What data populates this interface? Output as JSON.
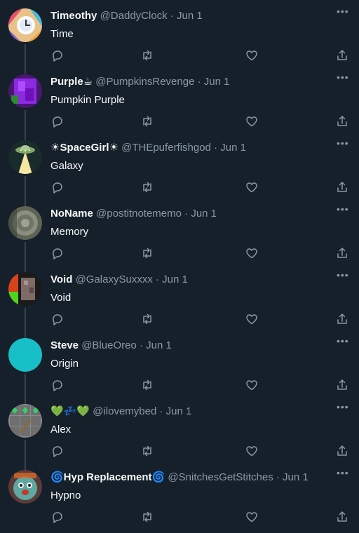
{
  "colors": {
    "background": "#15202b",
    "text": "#f7f9f9",
    "muted": "#8b98a5",
    "thread_line": "#38444d"
  },
  "icons": {
    "reply": "reply-icon",
    "retweet": "retweet-icon",
    "like": "heart-icon",
    "share": "share-icon",
    "more": "more-icon"
  },
  "tweets": [
    {
      "name": "Timeothy",
      "handle": "@DaddyClock",
      "sep": "·",
      "date": "Jun 1",
      "text": "Time",
      "more": "•••"
    },
    {
      "name": "Purple☕",
      "handle": "@PumpkinsRevenge",
      "sep": "·",
      "date": "Jun 1",
      "text": "Pumpkin Purple",
      "more": "•••"
    },
    {
      "name": "☀SpaceGirl☀",
      "handle": "@THEpuferfishgod",
      "sep": "·",
      "date": "Jun 1",
      "text": "Galaxy",
      "more": "•••"
    },
    {
      "name": "NoName",
      "handle": "@postitnotememo",
      "sep": "·",
      "date": "Jun 1",
      "text": "Memory",
      "more": "•••"
    },
    {
      "name": "Void",
      "handle": "@GalaxySuxxxx",
      "sep": "·",
      "date": "Jun 1",
      "text": "Void",
      "more": "•••"
    },
    {
      "name": "Steve",
      "handle": "@BlueOreo",
      "sep": "·",
      "date": "Jun 1",
      "text": "Origin",
      "more": "•••"
    },
    {
      "name": "💚💤💚",
      "handle": "@ilovemybed",
      "sep": "·",
      "date": "Jun 1",
      "text": "Alex",
      "more": "•••"
    },
    {
      "name": "🌀Hyp Replacement🌀",
      "handle": "@SnitchesGetStitches",
      "sep": "·",
      "date": "Jun 1",
      "text": "Hypno",
      "more": "•••"
    }
  ]
}
